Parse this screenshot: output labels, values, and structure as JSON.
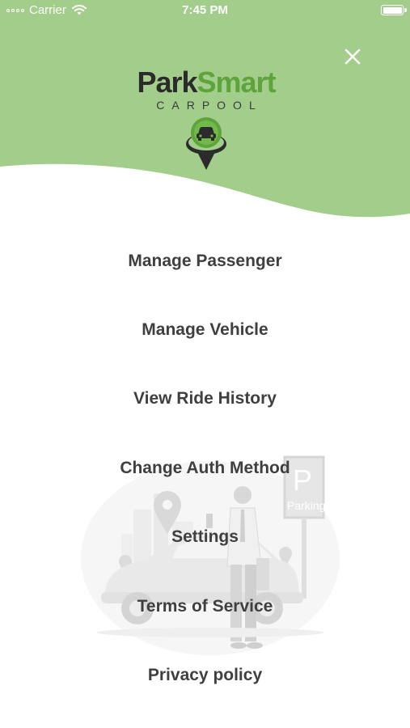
{
  "status_bar": {
    "carrier": "Carrier",
    "time": "7:45 PM"
  },
  "colors": {
    "header_green": "#a2cd8b",
    "brand_green": "#5ea43b",
    "menu_text": "#3f3f3f"
  },
  "header": {
    "close_icon": "close-icon",
    "logo": {
      "title_part1": "Park",
      "title_part2": "Smart",
      "subtitle": "CARPOOL"
    }
  },
  "menu": {
    "items": [
      {
        "label": "Manage Passenger"
      },
      {
        "label": "Manage Vehicle"
      },
      {
        "label": "View Ride History"
      },
      {
        "label": "Change Auth Method"
      },
      {
        "label": "Settings"
      },
      {
        "label": "Terms of Service"
      },
      {
        "label": "Privacy policy"
      }
    ]
  },
  "illustration": {
    "sign_text": "Parking",
    "sign_letter": "P"
  }
}
